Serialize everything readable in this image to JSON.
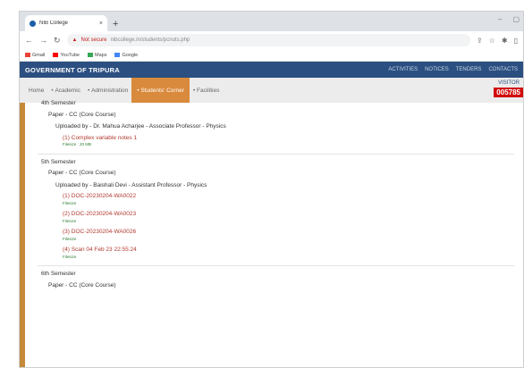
{
  "browser": {
    "tab_title": "NIB College",
    "tab_close": "×",
    "new_tab": "+",
    "security": "Not secure",
    "url": "nibcollege.in/students/pcnots.php"
  },
  "bookmarks": [
    {
      "label": "Gmail",
      "color": "#ea4335"
    },
    {
      "label": "YouTube",
      "color": "#ff0000"
    },
    {
      "label": "Maps",
      "color": "#34a853"
    },
    {
      "label": "Google",
      "color": "#4285f4"
    }
  ],
  "site": {
    "title": "GOVERNMENT OF TRIPURA",
    "top_nav": [
      "ACTIVITIES",
      "NOTICES",
      "TENDERS",
      "CONTACTS"
    ]
  },
  "menu": [
    "Home",
    "Academic",
    "Administration",
    "Students' Corner",
    "Facilities"
  ],
  "menu_active_index": 3,
  "visitor": {
    "label": "VISITOR",
    "count": "005785"
  },
  "content": {
    "sem4": {
      "title": "4th Semester",
      "paper": "Paper - CC (Core Course)",
      "uploaded": "Uploaded by - Dr. Mahua Acharjee - Associate Professor - Physics",
      "file1": "(1) Complex variable notes 1",
      "size1": "Filesize : 20 MB"
    },
    "sem5": {
      "title": "5th Semester",
      "paper": "Paper - CC (Core Course)",
      "uploaded": "Uploaded by - Baishali Devi - Assistant Professor - Physics",
      "files": [
        {
          "name": "(1) DOC-20230204-WA0022",
          "size": "Filesize"
        },
        {
          "name": "(2) DOC-20230204-WA0023",
          "size": "Filesize"
        },
        {
          "name": "(3) DOC-20230204-WA0026",
          "size": "Filesize"
        },
        {
          "name": "(4) Scan 04 Feb 23 22:55:24",
          "size": "Filesize"
        }
      ]
    },
    "sem6": {
      "title": "6th Semester",
      "paper": "Paper - CC (Core Course)"
    }
  }
}
